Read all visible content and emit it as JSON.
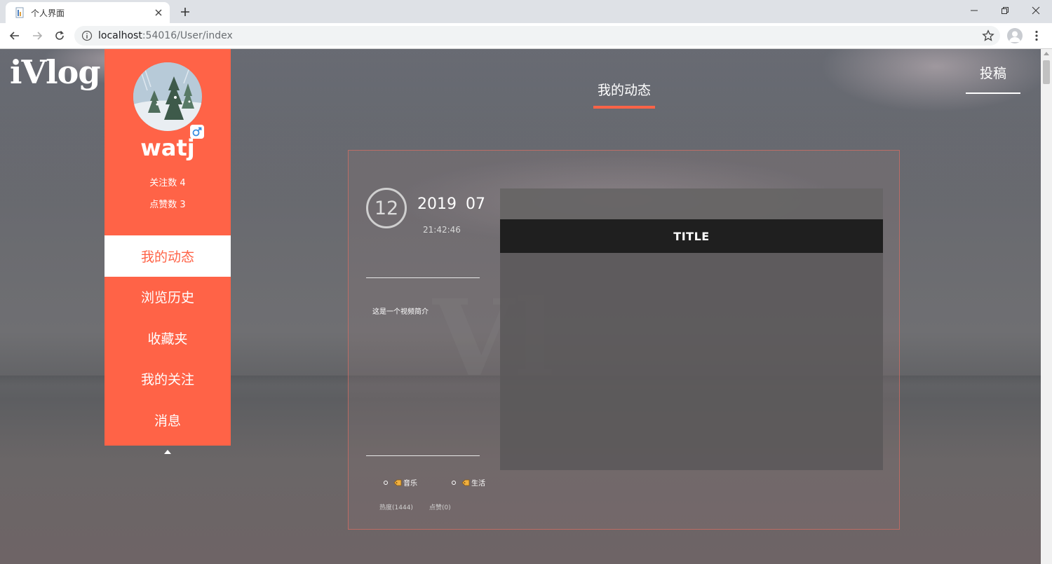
{
  "browser": {
    "tab_title": "个人界面",
    "url_host": "localhost",
    "url_path": ":54016/User/index"
  },
  "site": {
    "logo": "iVlog",
    "submit_label": "投稿",
    "header_tab": "我的动态"
  },
  "profile": {
    "username": "watj",
    "follow_count_label": "关注数 4",
    "like_count_label": "点赞数 3",
    "gender_icon": "male-icon"
  },
  "menu": {
    "items": [
      {
        "label": "我的动态",
        "active": true
      },
      {
        "label": "浏览历史",
        "active": false
      },
      {
        "label": "收藏夹",
        "active": false
      },
      {
        "label": "我的关注",
        "active": false
      },
      {
        "label": "消息",
        "active": false
      }
    ]
  },
  "post": {
    "day": "12",
    "year_month": "2019 07",
    "time": "21:42:46",
    "description": "这是一个视频简介",
    "tags": [
      "音乐",
      "生活"
    ],
    "heat_label": "热度(1444)",
    "likes_label": "点赞(0)",
    "video_title": "TITLE"
  },
  "colors": {
    "accent": "#ff6347",
    "tab_bg": "#dee1e6"
  }
}
